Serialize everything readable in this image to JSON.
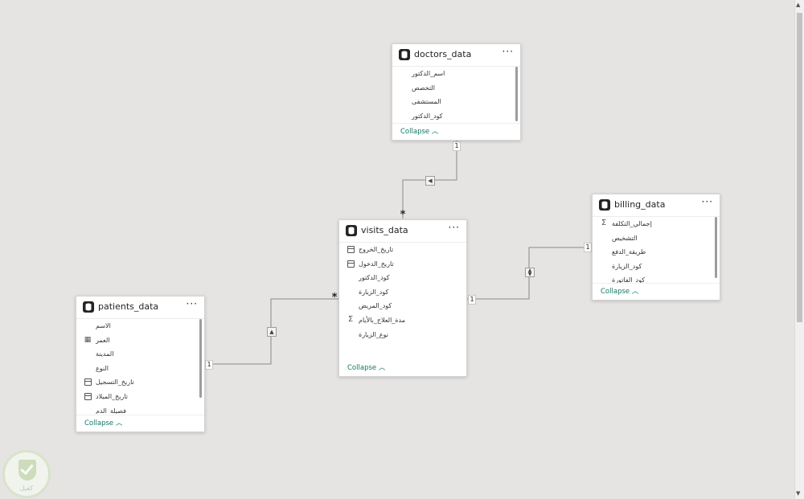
{
  "tables": {
    "doctors": {
      "title": "doctors_data",
      "more": "···",
      "fields": [
        {
          "label": "اسم_الدكتور",
          "icon": "none"
        },
        {
          "label": "التخصص",
          "icon": "none"
        },
        {
          "label": "المستشفى",
          "icon": "none"
        },
        {
          "label": "كود_الدكتور",
          "icon": "none"
        }
      ],
      "collapse": "Collapse"
    },
    "billing": {
      "title": "billing_data",
      "more": "···",
      "fields": [
        {
          "label": "إجمالي_التكلفة",
          "icon": "sum"
        },
        {
          "label": "التشخيص",
          "icon": "none"
        },
        {
          "label": "طريقة_الدفع",
          "icon": "none"
        },
        {
          "label": "كود_الزيارة",
          "icon": "none"
        },
        {
          "label": "كود_الفاتورة",
          "icon": "none"
        }
      ],
      "collapse": "Collapse"
    },
    "visits": {
      "title": "visits_data",
      "more": "···",
      "fields": [
        {
          "label": "تاريخ_الخروج",
          "icon": "calendar"
        },
        {
          "label": "تاريخ_الدخول",
          "icon": "calendar"
        },
        {
          "label": "كود_الدكتور",
          "icon": "none"
        },
        {
          "label": "كود_الزيارة",
          "icon": "none"
        },
        {
          "label": "كود_المريض",
          "icon": "none"
        },
        {
          "label": "مدة_العلاج_بالأيام",
          "icon": "sum"
        },
        {
          "label": "نوع_الزيارة",
          "icon": "none"
        }
      ],
      "collapse": "Collapse"
    },
    "patients": {
      "title": "patients_data",
      "more": "···",
      "fields": [
        {
          "label": "الاسم",
          "icon": "none"
        },
        {
          "label": "العمر",
          "icon": "calc"
        },
        {
          "label": "المدينة",
          "icon": "none"
        },
        {
          "label": "النوع",
          "icon": "none"
        },
        {
          "label": "تاريخ_التسجيل",
          "icon": "calendar"
        },
        {
          "label": "تاريخ_الميلاد",
          "icon": "calendar"
        },
        {
          "label": "فصيلة_الدم",
          "icon": "none"
        }
      ],
      "collapse": "Collapse"
    }
  },
  "relationships": {
    "doctors_visits": {
      "one": "1",
      "many": "*"
    },
    "visits_billing": {
      "left": "1",
      "right": "1"
    },
    "patients_visits": {
      "one": "1",
      "many": "*"
    }
  },
  "logo_text": "كفيل",
  "colors": {
    "accent": "#117865",
    "canvas": "#e5e4e2",
    "card": "#ffffff",
    "line": "#8a8a8a"
  }
}
